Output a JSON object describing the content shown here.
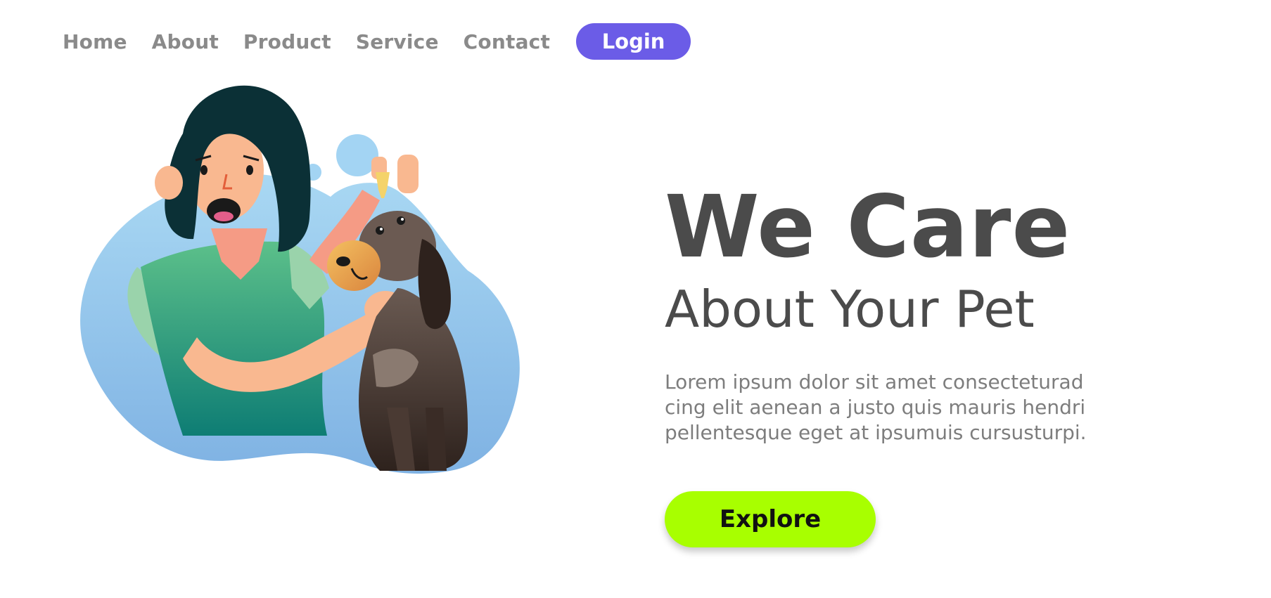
{
  "nav": {
    "items": [
      {
        "label": "Home"
      },
      {
        "label": "About"
      },
      {
        "label": "Product"
      },
      {
        "label": "Service"
      },
      {
        "label": "Contact"
      }
    ],
    "login_label": "Login"
  },
  "hero": {
    "headline": "We Care",
    "subheadline": "About Your Pet",
    "paragraph_lines": [
      "Lorem ipsum dolor sit amet consecteturad",
      "cing elit aenean a justo quis mauris hendri",
      "pellentesque eget at ipsumuis cursusturpi."
    ],
    "cta_label": "Explore"
  },
  "colors": {
    "login_bg": "#6b5ce7",
    "cta_bg": "#a8ff00",
    "heading": "#4b4b4b",
    "nav_text": "#8a8a8a",
    "body_text": "#7d7d7d",
    "blob": "#8fc4ec"
  },
  "illustration": {
    "icon": "woman-giving-eye-drops-to-dog-illustration"
  }
}
